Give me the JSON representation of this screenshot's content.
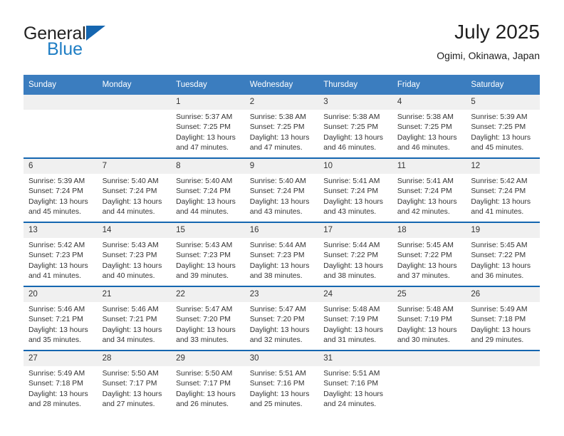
{
  "brand": {
    "name_top": "General",
    "name_bottom": "Blue",
    "triangle_color": "#1566b0",
    "blue_color": "#1f7ec4"
  },
  "header": {
    "title": "July 2025",
    "subtitle": "Ogimi, Okinawa, Japan"
  },
  "colors": {
    "header_bar": "#3b7dbf",
    "row_divider": "#1566b0",
    "daynum_band": "#f0f0f0",
    "text": "#333333"
  },
  "weekday_headers": [
    "Sunday",
    "Monday",
    "Tuesday",
    "Wednesday",
    "Thursday",
    "Friday",
    "Saturday"
  ],
  "weeks": [
    [
      {
        "day": "",
        "lines": []
      },
      {
        "day": "",
        "lines": []
      },
      {
        "day": "1",
        "lines": [
          "Sunrise: 5:37 AM",
          "Sunset: 7:25 PM",
          "Daylight: 13 hours and 47 minutes."
        ]
      },
      {
        "day": "2",
        "lines": [
          "Sunrise: 5:38 AM",
          "Sunset: 7:25 PM",
          "Daylight: 13 hours and 47 minutes."
        ]
      },
      {
        "day": "3",
        "lines": [
          "Sunrise: 5:38 AM",
          "Sunset: 7:25 PM",
          "Daylight: 13 hours and 46 minutes."
        ]
      },
      {
        "day": "4",
        "lines": [
          "Sunrise: 5:38 AM",
          "Sunset: 7:25 PM",
          "Daylight: 13 hours and 46 minutes."
        ]
      },
      {
        "day": "5",
        "lines": [
          "Sunrise: 5:39 AM",
          "Sunset: 7:25 PM",
          "Daylight: 13 hours and 45 minutes."
        ]
      }
    ],
    [
      {
        "day": "6",
        "lines": [
          "Sunrise: 5:39 AM",
          "Sunset: 7:24 PM",
          "Daylight: 13 hours and 45 minutes."
        ]
      },
      {
        "day": "7",
        "lines": [
          "Sunrise: 5:40 AM",
          "Sunset: 7:24 PM",
          "Daylight: 13 hours and 44 minutes."
        ]
      },
      {
        "day": "8",
        "lines": [
          "Sunrise: 5:40 AM",
          "Sunset: 7:24 PM",
          "Daylight: 13 hours and 44 minutes."
        ]
      },
      {
        "day": "9",
        "lines": [
          "Sunrise: 5:40 AM",
          "Sunset: 7:24 PM",
          "Daylight: 13 hours and 43 minutes."
        ]
      },
      {
        "day": "10",
        "lines": [
          "Sunrise: 5:41 AM",
          "Sunset: 7:24 PM",
          "Daylight: 13 hours and 43 minutes."
        ]
      },
      {
        "day": "11",
        "lines": [
          "Sunrise: 5:41 AM",
          "Sunset: 7:24 PM",
          "Daylight: 13 hours and 42 minutes."
        ]
      },
      {
        "day": "12",
        "lines": [
          "Sunrise: 5:42 AM",
          "Sunset: 7:24 PM",
          "Daylight: 13 hours and 41 minutes."
        ]
      }
    ],
    [
      {
        "day": "13",
        "lines": [
          "Sunrise: 5:42 AM",
          "Sunset: 7:23 PM",
          "Daylight: 13 hours and 41 minutes."
        ]
      },
      {
        "day": "14",
        "lines": [
          "Sunrise: 5:43 AM",
          "Sunset: 7:23 PM",
          "Daylight: 13 hours and 40 minutes."
        ]
      },
      {
        "day": "15",
        "lines": [
          "Sunrise: 5:43 AM",
          "Sunset: 7:23 PM",
          "Daylight: 13 hours and 39 minutes."
        ]
      },
      {
        "day": "16",
        "lines": [
          "Sunrise: 5:44 AM",
          "Sunset: 7:23 PM",
          "Daylight: 13 hours and 38 minutes."
        ]
      },
      {
        "day": "17",
        "lines": [
          "Sunrise: 5:44 AM",
          "Sunset: 7:22 PM",
          "Daylight: 13 hours and 38 minutes."
        ]
      },
      {
        "day": "18",
        "lines": [
          "Sunrise: 5:45 AM",
          "Sunset: 7:22 PM",
          "Daylight: 13 hours and 37 minutes."
        ]
      },
      {
        "day": "19",
        "lines": [
          "Sunrise: 5:45 AM",
          "Sunset: 7:22 PM",
          "Daylight: 13 hours and 36 minutes."
        ]
      }
    ],
    [
      {
        "day": "20",
        "lines": [
          "Sunrise: 5:46 AM",
          "Sunset: 7:21 PM",
          "Daylight: 13 hours and 35 minutes."
        ]
      },
      {
        "day": "21",
        "lines": [
          "Sunrise: 5:46 AM",
          "Sunset: 7:21 PM",
          "Daylight: 13 hours and 34 minutes."
        ]
      },
      {
        "day": "22",
        "lines": [
          "Sunrise: 5:47 AM",
          "Sunset: 7:20 PM",
          "Daylight: 13 hours and 33 minutes."
        ]
      },
      {
        "day": "23",
        "lines": [
          "Sunrise: 5:47 AM",
          "Sunset: 7:20 PM",
          "Daylight: 13 hours and 32 minutes."
        ]
      },
      {
        "day": "24",
        "lines": [
          "Sunrise: 5:48 AM",
          "Sunset: 7:19 PM",
          "Daylight: 13 hours and 31 minutes."
        ]
      },
      {
        "day": "25",
        "lines": [
          "Sunrise: 5:48 AM",
          "Sunset: 7:19 PM",
          "Daylight: 13 hours and 30 minutes."
        ]
      },
      {
        "day": "26",
        "lines": [
          "Sunrise: 5:49 AM",
          "Sunset: 7:18 PM",
          "Daylight: 13 hours and 29 minutes."
        ]
      }
    ],
    [
      {
        "day": "27",
        "lines": [
          "Sunrise: 5:49 AM",
          "Sunset: 7:18 PM",
          "Daylight: 13 hours and 28 minutes."
        ]
      },
      {
        "day": "28",
        "lines": [
          "Sunrise: 5:50 AM",
          "Sunset: 7:17 PM",
          "Daylight: 13 hours and 27 minutes."
        ]
      },
      {
        "day": "29",
        "lines": [
          "Sunrise: 5:50 AM",
          "Sunset: 7:17 PM",
          "Daylight: 13 hours and 26 minutes."
        ]
      },
      {
        "day": "30",
        "lines": [
          "Sunrise: 5:51 AM",
          "Sunset: 7:16 PM",
          "Daylight: 13 hours and 25 minutes."
        ]
      },
      {
        "day": "31",
        "lines": [
          "Sunrise: 5:51 AM",
          "Sunset: 7:16 PM",
          "Daylight: 13 hours and 24 minutes."
        ]
      },
      {
        "day": "",
        "lines": []
      },
      {
        "day": "",
        "lines": []
      }
    ]
  ]
}
